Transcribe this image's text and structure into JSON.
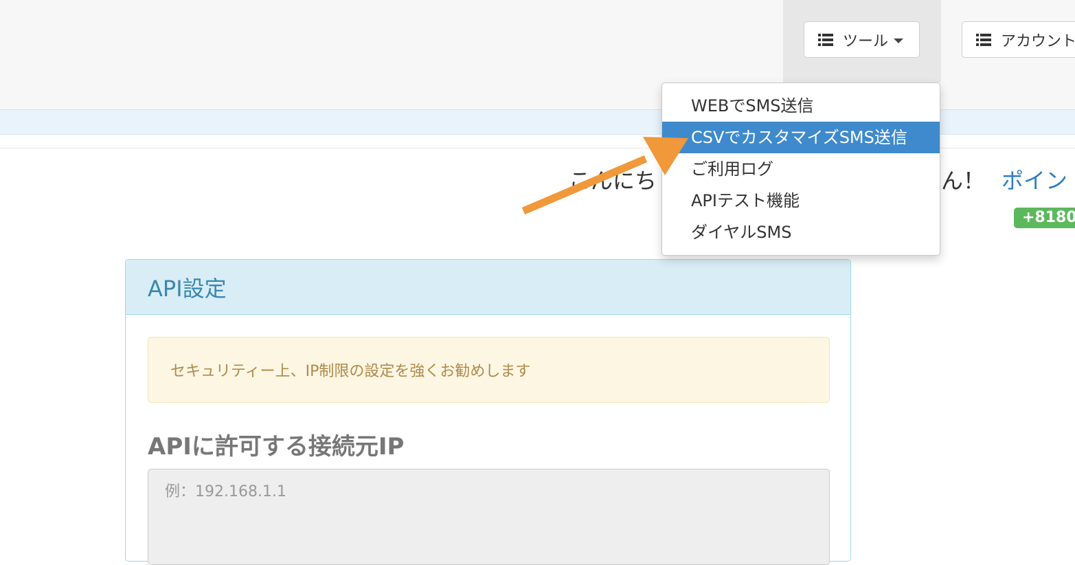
{
  "navbar": {
    "tools_label": "ツール",
    "account_label": "アカウント"
  },
  "dropdown": {
    "items": [
      {
        "label": "WEBでSMS送信",
        "active": false
      },
      {
        "label": "CSVでカスタマイズSMS送信",
        "active": true
      },
      {
        "label": "ご利用ログ",
        "active": false
      },
      {
        "label": "APIテスト機能",
        "active": false
      },
      {
        "label": "ダイヤルSMS",
        "active": false
      }
    ]
  },
  "greeting": {
    "prefix": "こんにち",
    "suffix": "ん！",
    "points_link": "ポイン",
    "phone_badge": "+8180"
  },
  "panel": {
    "title": "API設定",
    "alert_text": "セキュリティー上、IP制限の設定を強くお勧めします",
    "field_label": "APIに許可する接続元IP",
    "ip_placeholder": "例：192.168.1.1"
  },
  "colors": {
    "accent": "#3e8acc",
    "annotation_arrow": "#f0983a",
    "badge_green": "#5cb85c"
  },
  "icons": {
    "nav": "list-icon",
    "caret": "caret-down-icon",
    "annotation": "arrow-annotation"
  }
}
